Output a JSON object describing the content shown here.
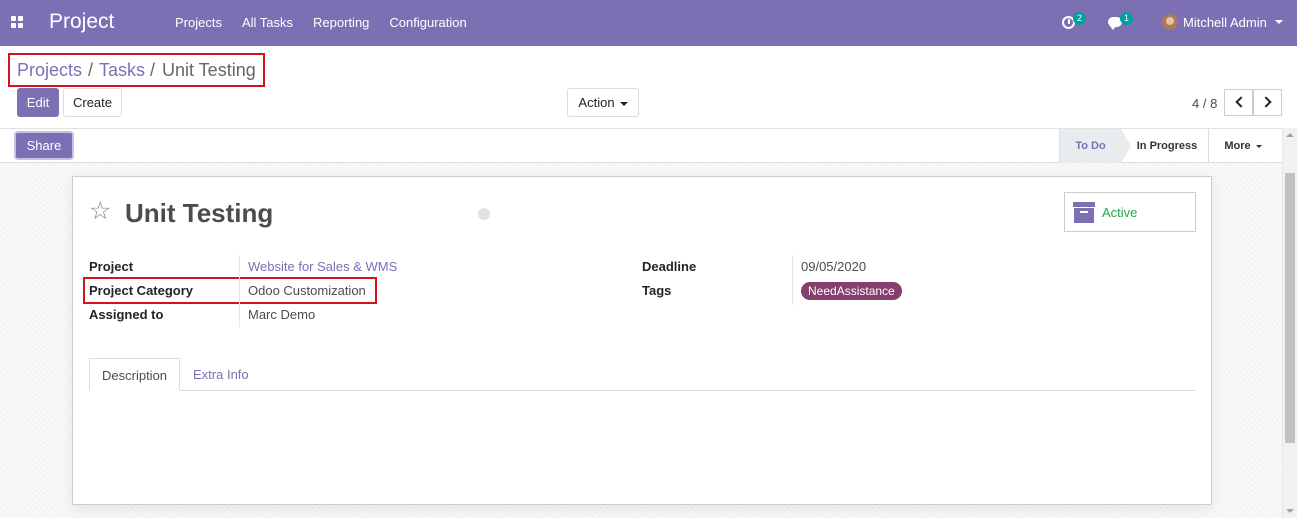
{
  "navbar": {
    "app_name": "Project",
    "menu": [
      "Projects",
      "All Tasks",
      "Reporting",
      "Configuration"
    ],
    "activity_count": "2",
    "message_count": "1",
    "user_name": "Mitchell Admin"
  },
  "breadcrumb": {
    "items": [
      "Projects",
      "Tasks"
    ],
    "separator": "/",
    "current": "Unit Testing"
  },
  "buttons": {
    "edit": "Edit",
    "create": "Create",
    "action": "Action",
    "share": "Share"
  },
  "pager": {
    "value": "4 / 8"
  },
  "stages": [
    "To Do",
    "In Progress",
    "More"
  ],
  "active_stage": "To Do",
  "task": {
    "title": "Unit Testing",
    "status_button": "Active",
    "fields": {
      "project": {
        "label": "Project",
        "value": "Website for Sales & WMS"
      },
      "project_category": {
        "label": "Project Category",
        "value": "Odoo Customization"
      },
      "assigned_to": {
        "label": "Assigned to",
        "value": "Marc Demo"
      },
      "deadline": {
        "label": "Deadline",
        "value": "09/05/2020"
      },
      "tags": {
        "label": "Tags",
        "value": "NeedAssistance"
      }
    }
  },
  "tabs": [
    "Description",
    "Extra Info"
  ],
  "colors": {
    "brand": "#7c6fb4",
    "highlight": "#d5111a",
    "tag": "#853f6c",
    "active_text": "#28a745"
  }
}
